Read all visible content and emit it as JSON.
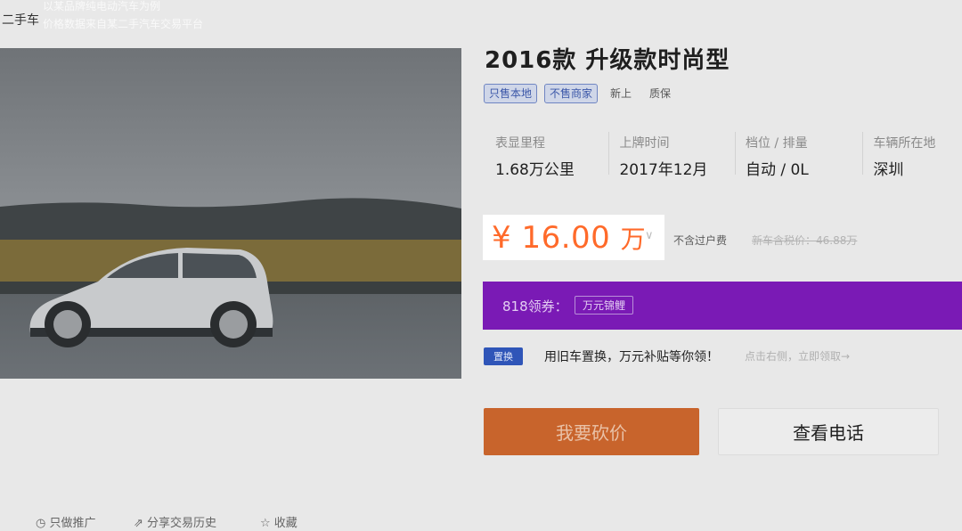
{
  "header": {
    "site_name": "二手车",
    "ad_line1": "以某品牌纯电动汽车为例",
    "ad_line2": "价格数据来自某二手汽车交易平台"
  },
  "car": {
    "title": "2016款 升级款时尚型",
    "tags": [
      "只售本地",
      "不售商家",
      "新上",
      "质保"
    ]
  },
  "specs": [
    {
      "label": "表显里程",
      "value": "1.68万公里"
    },
    {
      "label": "上牌时间",
      "value": "2017年12月"
    },
    {
      "label": "档位 / 排量",
      "value": "自动 / 0L"
    },
    {
      "label": "车辆所在地",
      "value": "深圳"
    }
  ],
  "price": {
    "symbol": "¥",
    "amount": "16.00",
    "unit": "万",
    "note": "不含过户费",
    "new_car_price": "新车含税价：46.88万"
  },
  "coupon": {
    "label": "818领券：",
    "chip": "万元锦鲤"
  },
  "trade_in": {
    "badge": "置换",
    "text": "用旧车置换，万元补贴等你领！",
    "link": "点击右侧，立即领取→"
  },
  "buttons": {
    "bargain": "我要砍价",
    "phone": "查看电话"
  },
  "bottom_actions": [
    "只做推广",
    "分享交易历史",
    "收藏"
  ],
  "colors": {
    "price": "#ff6a2a",
    "coupon_bg": "#7a1ab5",
    "bargain_bg": "#c8642c",
    "tag_border": "#6f85c2"
  }
}
